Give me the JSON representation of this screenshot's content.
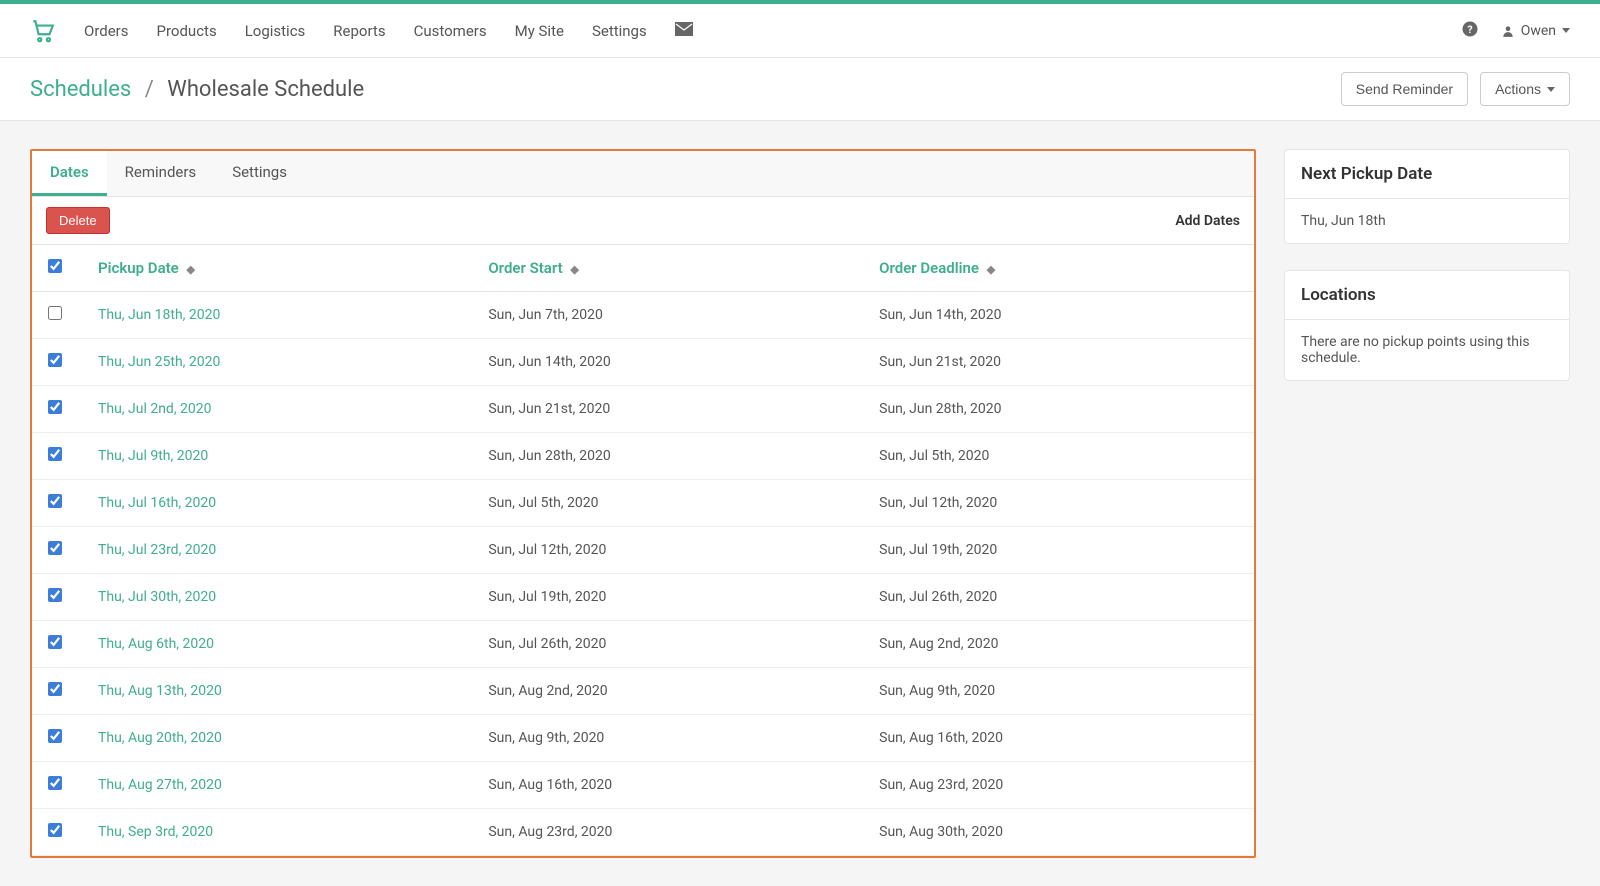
{
  "nav": {
    "items": [
      "Orders",
      "Products",
      "Logistics",
      "Reports",
      "Customers",
      "My Site",
      "Settings"
    ]
  },
  "user": {
    "name": "Owen"
  },
  "breadcrumb": {
    "root": "Schedules",
    "current": "Wholesale Schedule"
  },
  "page_actions": {
    "send_reminder": "Send Reminder",
    "actions": "Actions"
  },
  "tabs": {
    "dates": "Dates",
    "reminders": "Reminders",
    "settings": "Settings"
  },
  "toolbar": {
    "delete": "Delete",
    "add_dates": "Add Dates"
  },
  "table": {
    "headers": {
      "pickup_date": "Pickup Date",
      "order_start": "Order Start",
      "order_deadline": "Order Deadline"
    },
    "select_all_checked": true,
    "rows": [
      {
        "checked": false,
        "pickup": "Thu, Jun 18th, 2020",
        "start": "Sun, Jun 7th, 2020",
        "deadline": "Sun, Jun 14th, 2020"
      },
      {
        "checked": true,
        "pickup": "Thu, Jun 25th, 2020",
        "start": "Sun, Jun 14th, 2020",
        "deadline": "Sun, Jun 21st, 2020"
      },
      {
        "checked": true,
        "pickup": "Thu, Jul 2nd, 2020",
        "start": "Sun, Jun 21st, 2020",
        "deadline": "Sun, Jun 28th, 2020"
      },
      {
        "checked": true,
        "pickup": "Thu, Jul 9th, 2020",
        "start": "Sun, Jun 28th, 2020",
        "deadline": "Sun, Jul 5th, 2020"
      },
      {
        "checked": true,
        "pickup": "Thu, Jul 16th, 2020",
        "start": "Sun, Jul 5th, 2020",
        "deadline": "Sun, Jul 12th, 2020"
      },
      {
        "checked": true,
        "pickup": "Thu, Jul 23rd, 2020",
        "start": "Sun, Jul 12th, 2020",
        "deadline": "Sun, Jul 19th, 2020"
      },
      {
        "checked": true,
        "pickup": "Thu, Jul 30th, 2020",
        "start": "Sun, Jul 19th, 2020",
        "deadline": "Sun, Jul 26th, 2020"
      },
      {
        "checked": true,
        "pickup": "Thu, Aug 6th, 2020",
        "start": "Sun, Jul 26th, 2020",
        "deadline": "Sun, Aug 2nd, 2020"
      },
      {
        "checked": true,
        "pickup": "Thu, Aug 13th, 2020",
        "start": "Sun, Aug 2nd, 2020",
        "deadline": "Sun, Aug 9th, 2020"
      },
      {
        "checked": true,
        "pickup": "Thu, Aug 20th, 2020",
        "start": "Sun, Aug 9th, 2020",
        "deadline": "Sun, Aug 16th, 2020"
      },
      {
        "checked": true,
        "pickup": "Thu, Aug 27th, 2020",
        "start": "Sun, Aug 16th, 2020",
        "deadline": "Sun, Aug 23rd, 2020"
      },
      {
        "checked": true,
        "pickup": "Thu, Sep 3rd, 2020",
        "start": "Sun, Aug 23rd, 2020",
        "deadline": "Sun, Aug 30th, 2020"
      }
    ]
  },
  "sidebar": {
    "next_pickup": {
      "title": "Next Pickup Date",
      "value": "Thu, Jun 18th"
    },
    "locations": {
      "title": "Locations",
      "empty": "There are no pickup points using this schedule."
    }
  }
}
